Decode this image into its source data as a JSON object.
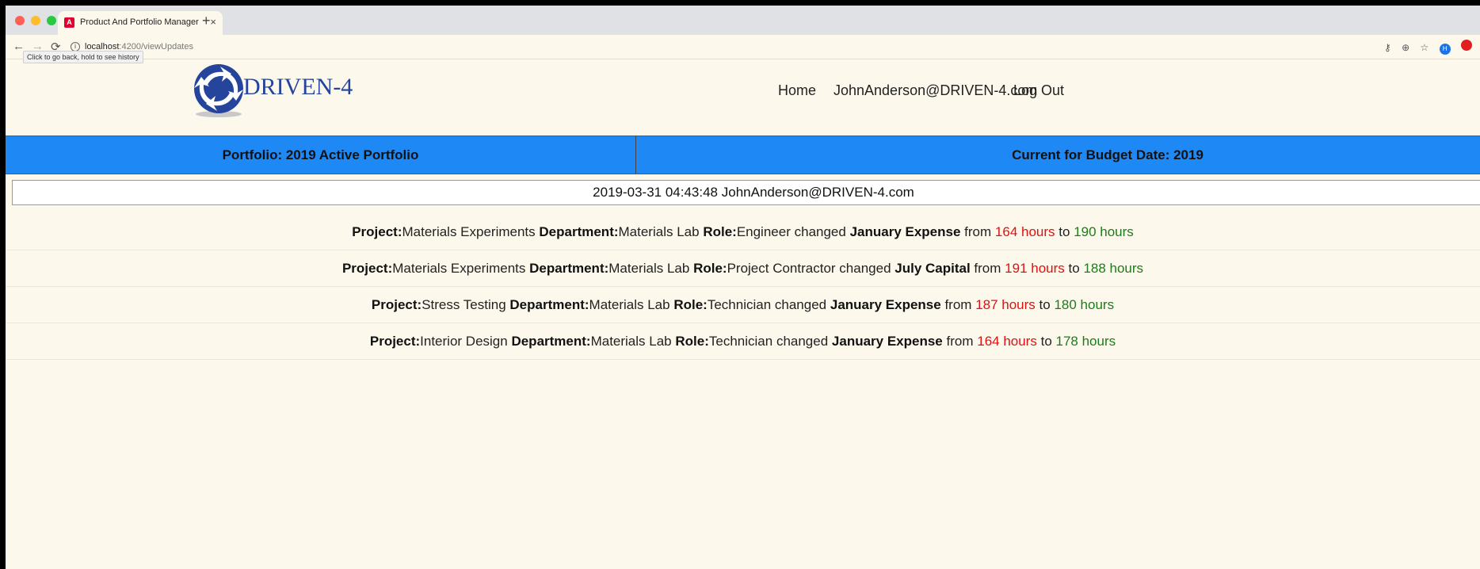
{
  "browser": {
    "tab_title": "Product And Portfolio Manager",
    "tab_close": "×",
    "new_tab": "+",
    "url_host": "localhost",
    "url_path": ":4200/viewUpdates",
    "back_tooltip": "Click to go back, hold to see history",
    "profile_initial": "H"
  },
  "header": {
    "brand": "DRIVEN-4",
    "nav": {
      "home": "Home",
      "user": "JohnAnderson@DRIVEN-4.com",
      "logout": "Log Out"
    }
  },
  "banner": {
    "portfolio": "Portfolio: 2019 Active Portfolio",
    "budget_date": "Current for Budget Date: 2019"
  },
  "update_group": {
    "header": "2019-03-31 04:43:48 JohnAnderson@DRIVEN-4.com",
    "labels": {
      "project": "Project:",
      "department": "Department:",
      "role": "Role:",
      "changed": "changed",
      "from": "from",
      "to": "to"
    },
    "rows": [
      {
        "project": "Materials Experiments",
        "department": "Materials Lab",
        "role": "Engineer",
        "field": "January Expense",
        "from": "164 hours",
        "to": "190 hours"
      },
      {
        "project": "Materials Experiments",
        "department": "Materials Lab",
        "role": "Project Contractor",
        "field": "July Capital",
        "from": "191 hours",
        "to": "188 hours"
      },
      {
        "project": "Stress Testing",
        "department": "Materials Lab",
        "role": "Technician",
        "field": "January Expense",
        "from": "187 hours",
        "to": "180 hours"
      },
      {
        "project": "Interior Design",
        "department": "Materials Lab",
        "role": "Technician",
        "field": "January Expense",
        "from": "164 hours",
        "to": "178 hours"
      }
    ]
  },
  "colors": {
    "banner": "#1e88f5",
    "page_background": "#fdf8ec",
    "from_value": "#e01010",
    "to_value": "#1a7d1a",
    "brand": "#25449b"
  }
}
